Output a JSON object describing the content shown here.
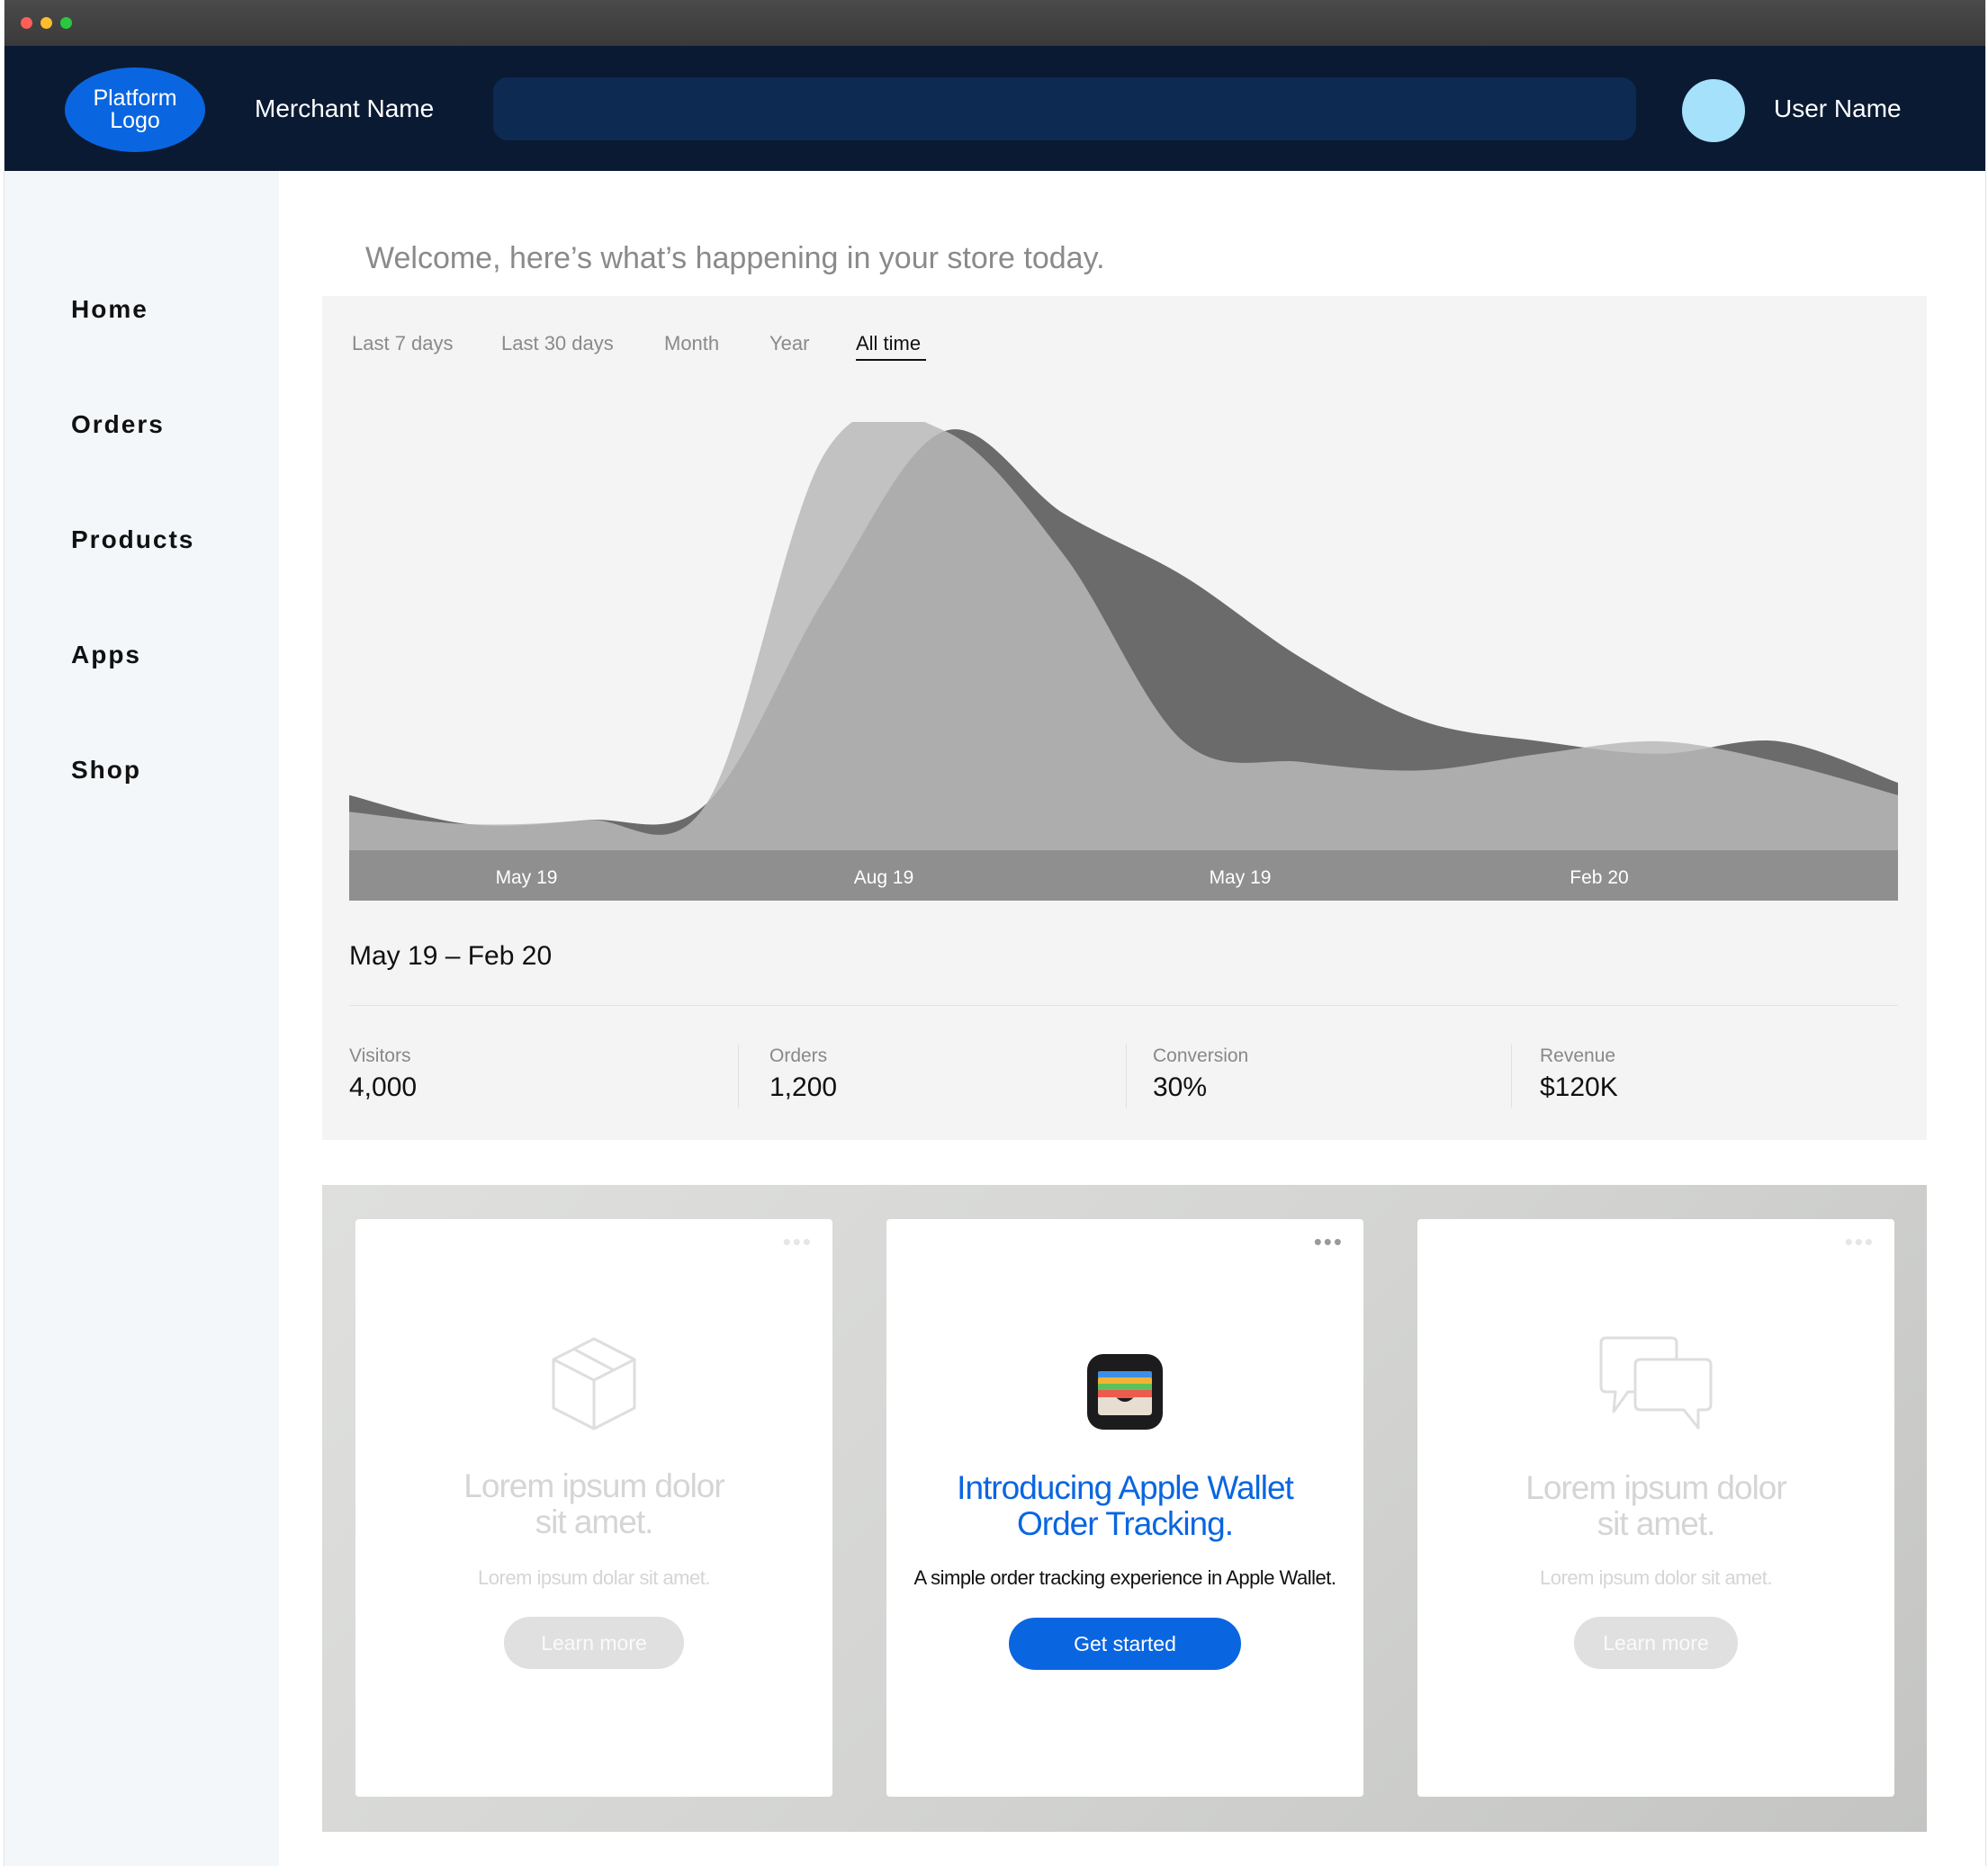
{
  "window": {
    "traffic_lights": [
      "close",
      "minimize",
      "zoom"
    ]
  },
  "header": {
    "logo_text": "Platform\nLogo",
    "merchant_name": "Merchant Name",
    "search_placeholder": "",
    "user_name": "User Name",
    "avatar_color": "#a6e1fc",
    "background": "#0a1a33"
  },
  "sidebar": {
    "items": [
      {
        "label": "Home"
      },
      {
        "label": "Orders"
      },
      {
        "label": "Products"
      },
      {
        "label": "Apps"
      },
      {
        "label": "Shop"
      }
    ]
  },
  "main": {
    "welcome": "Welcome, here’s what’s happening in your store today.",
    "tabs": [
      {
        "label": "Last 7 days",
        "active": false
      },
      {
        "label": "Last 30 days",
        "active": false
      },
      {
        "label": "Month",
        "active": false
      },
      {
        "label": "Year",
        "active": false
      },
      {
        "label": "All time",
        "active": true
      }
    ],
    "date_range": "May 19 – Feb 20",
    "metrics": [
      {
        "label": "Visitors",
        "value": "4,000"
      },
      {
        "label": "Orders",
        "value": "1,200"
      },
      {
        "label": "Conversion",
        "value": "30%"
      },
      {
        "label": "Revenue",
        "value": "$120K"
      }
    ]
  },
  "chart_data": {
    "type": "area",
    "title": "",
    "xlabel": "",
    "ylabel": "",
    "x_tick_labels": [
      "May 19",
      "Aug 19",
      "May 19",
      "Feb 20"
    ],
    "grid": false,
    "legend": "none",
    "series": [
      {
        "color": "#b9b9b9",
        "values": [
          0.08,
          0.05,
          0.06,
          0.1,
          0.95,
          1.0,
          0.7,
          0.25,
          0.2,
          0.18,
          0.22,
          0.25,
          0.2,
          0.12
        ]
      },
      {
        "color": "#6b6b6b",
        "values": [
          0.12,
          0.05,
          0.06,
          0.1,
          0.6,
          1.0,
          0.8,
          0.65,
          0.45,
          0.3,
          0.25,
          0.22,
          0.25,
          0.15
        ]
      }
    ]
  },
  "promo": {
    "cards": [
      {
        "icon": "box-icon",
        "title": "Lorem ipsum dolor\nsit amet.",
        "subtitle": "Lorem ipsum dolar sit amet.",
        "button": "Learn more",
        "state": "faded"
      },
      {
        "icon": "wallet-icon",
        "title": "Introducing Apple Wallet\nOrder Tracking.",
        "subtitle": "A simple order tracking experience in Apple Wallet.",
        "button": "Get started",
        "state": "featured"
      },
      {
        "icon": "chat-bubbles-icon",
        "title": "Lorem ipsum dolor\nsit amet.",
        "subtitle": "Lorem ipsum dolor sit amet.",
        "button": "Learn more",
        "state": "faded"
      }
    ],
    "more_icon_text": "•••"
  },
  "colors": {
    "accent": "#0a66e0",
    "sidebar_bg": "#f4f7fa",
    "card_bg": "#f4f4f4"
  }
}
